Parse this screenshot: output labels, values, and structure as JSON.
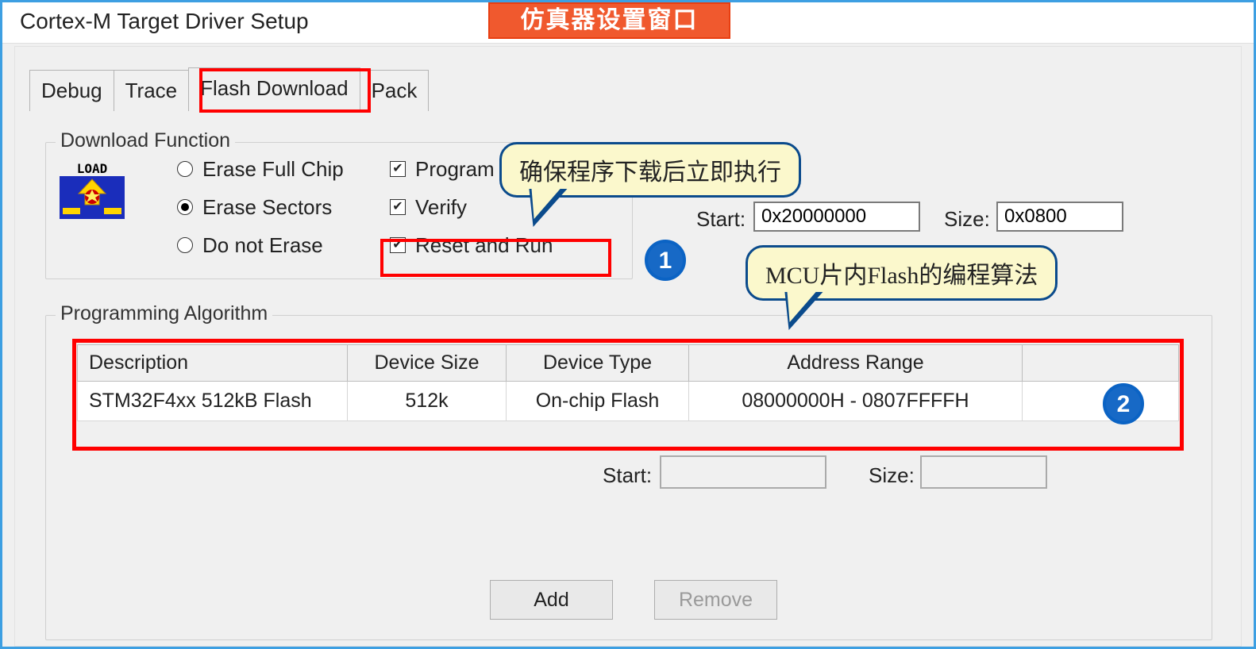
{
  "title": "Cortex-M Target Driver Setup",
  "top_badge": "仿真器设置窗口",
  "tabs": {
    "debug": "Debug",
    "trace": "Trace",
    "flash_download": "Flash Download",
    "pack": "Pack",
    "active": "flash_download"
  },
  "download_function": {
    "legend": "Download Function",
    "radios": {
      "erase_full_chip": "Erase Full Chip",
      "erase_sectors": "Erase Sectors",
      "do_not_erase": "Do not Erase",
      "selected": "erase_sectors"
    },
    "checks": {
      "program": {
        "label": "Program",
        "checked": true
      },
      "verify": {
        "label": "Verify",
        "checked": true
      },
      "reset_and_run": {
        "label": "Reset and Run",
        "checked": true
      }
    }
  },
  "ram": {
    "start_label": "Start:",
    "start_value": "0x20000000",
    "size_label": "Size:",
    "size_value": "0x0800"
  },
  "callouts": {
    "c1": "确保程序下载后立即执行",
    "c2": "MCU片内Flash的编程算法"
  },
  "circles": {
    "c1": "1",
    "c2": "2"
  },
  "programming_algorithm": {
    "legend": "Programming Algorithm",
    "headers": {
      "description": "Description",
      "device_size": "Device Size",
      "device_type": "Device Type",
      "address_range": "Address Range"
    },
    "rows": [
      {
        "description": "STM32F4xx 512kB Flash",
        "device_size": "512k",
        "device_type": "On-chip Flash",
        "address_range": "08000000H - 0807FFFFH"
      }
    ],
    "start_label": "Start:",
    "start_value": "",
    "size_label": "Size:",
    "size_value": ""
  },
  "buttons": {
    "add": "Add",
    "remove": "Remove"
  },
  "load_icon_text": "LOAD"
}
